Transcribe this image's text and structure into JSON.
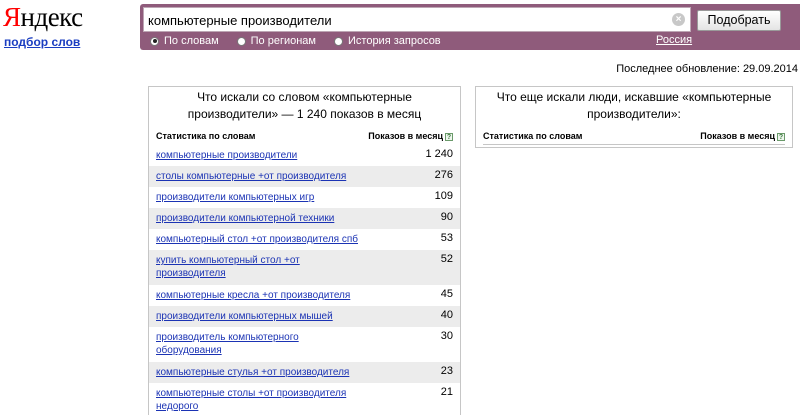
{
  "logo": {
    "brand_first": "Я",
    "brand_rest": "ндекс",
    "subtitle": "подбор слов"
  },
  "search": {
    "query": "компьютерные производители",
    "submit_label": "Подобрать",
    "modes": [
      {
        "label": "По словам",
        "selected": true
      },
      {
        "label": "По регионам",
        "selected": false
      },
      {
        "label": "История запросов",
        "selected": false
      }
    ],
    "region": "Россия"
  },
  "last_update": {
    "label": "Последнее обновление:",
    "date": "29.09.2014"
  },
  "left_panel": {
    "title": "Что искали со словом «компьютерные производители» — 1 240 показов в месяц",
    "col_keyword": "Статистика по словам",
    "col_count": "Показов в месяц",
    "rows": [
      {
        "keyword": "компьютерные производители",
        "count": "1 240"
      },
      {
        "keyword": "столы компьютерные +от производителя",
        "count": "276"
      },
      {
        "keyword": "производители компьютерных игр",
        "count": "109"
      },
      {
        "keyword": "производители компьютерной техники",
        "count": "90"
      },
      {
        "keyword": "компьютерный стол +от производителя спб",
        "count": "53"
      },
      {
        "keyword": "купить компьютерный стол +от производителя",
        "count": "52"
      },
      {
        "keyword": "компьютерные кресла +от производителя",
        "count": "45"
      },
      {
        "keyword": "производители компьютерных мышей",
        "count": "40"
      },
      {
        "keyword": "производитель компьютерного оборудования",
        "count": "30"
      },
      {
        "keyword": "компьютерные стулья +от производителя",
        "count": "23"
      },
      {
        "keyword": "компьютерные столы +от производителя недорого",
        "count": "21"
      }
    ]
  },
  "right_panel": {
    "title": "Что еще искали люди, искавшие «компьютерные производители»:",
    "col_keyword": "Статистика по словам",
    "col_count": "Показов в месяц"
  },
  "colors": {
    "accent": "#8f5b7b",
    "link": "#1b33b4",
    "logo_red": "#ff0000",
    "row_alt": "#ececec"
  }
}
